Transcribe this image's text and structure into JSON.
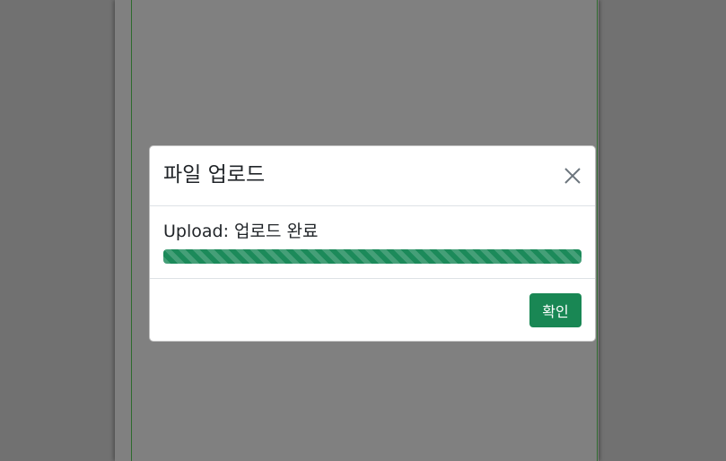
{
  "modal": {
    "title": "파일 업로드",
    "close_icon": "close-icon",
    "status_prefix": "Upload:",
    "status_text": "업로드 완료",
    "progress_percent": 100,
    "progress_color": "#1c8a5a",
    "confirm_label": "확인",
    "confirm_color": "#198754"
  }
}
